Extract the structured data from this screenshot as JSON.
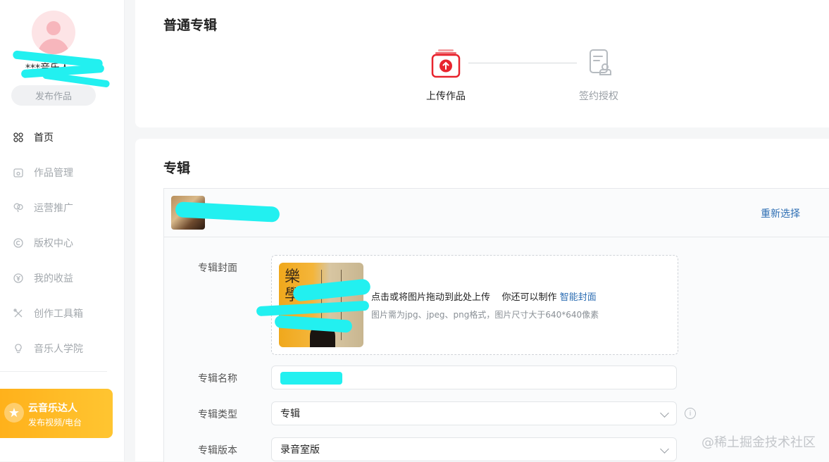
{
  "sidebar": {
    "username": "***音乐人",
    "publish_label": "发布作品",
    "nav": [
      {
        "label": "首页",
        "icon": "grid-icon",
        "active": true
      },
      {
        "label": "作品管理",
        "icon": "music-folder-icon",
        "active": false
      },
      {
        "label": "运营推广",
        "icon": "balloon-icon",
        "active": false
      },
      {
        "label": "版权中心",
        "icon": "copyright-icon",
        "active": false
      },
      {
        "label": "我的收益",
        "icon": "yen-icon",
        "active": false
      },
      {
        "label": "创作工具箱",
        "icon": "tools-icon",
        "active": false
      },
      {
        "label": "音乐人学院",
        "icon": "bulb-icon",
        "active": false
      }
    ],
    "promo": {
      "title": "云音乐达人",
      "subtitle": "发布视频/电台"
    }
  },
  "top": {
    "title": "普通专辑",
    "steps": [
      {
        "label": "上传作品",
        "state": "active",
        "icon": "upload-icon"
      },
      {
        "label": "签约授权",
        "state": "pending",
        "icon": "contract-icon"
      }
    ]
  },
  "album": {
    "title": "专辑",
    "reselect": "重新选择",
    "cover_label": "专辑封面",
    "upload_text": "点击或将图片拖动到此处上传",
    "upload_alt": "你还可以制作",
    "upload_link": "智能封面",
    "upload_hint": "图片需为jpg、jpeg、png格式，图片尺寸大于640*640像素",
    "name_label": "专辑名称",
    "name_value": "",
    "type_label": "专辑类型",
    "type_value": "专辑",
    "version_label": "专辑版本",
    "version_value": "录音室版"
  },
  "watermark": "@稀土掘金技术社区",
  "colors": {
    "accent": "#e8242e",
    "link": "#2d6eb3",
    "promo": "#ffb11b"
  }
}
